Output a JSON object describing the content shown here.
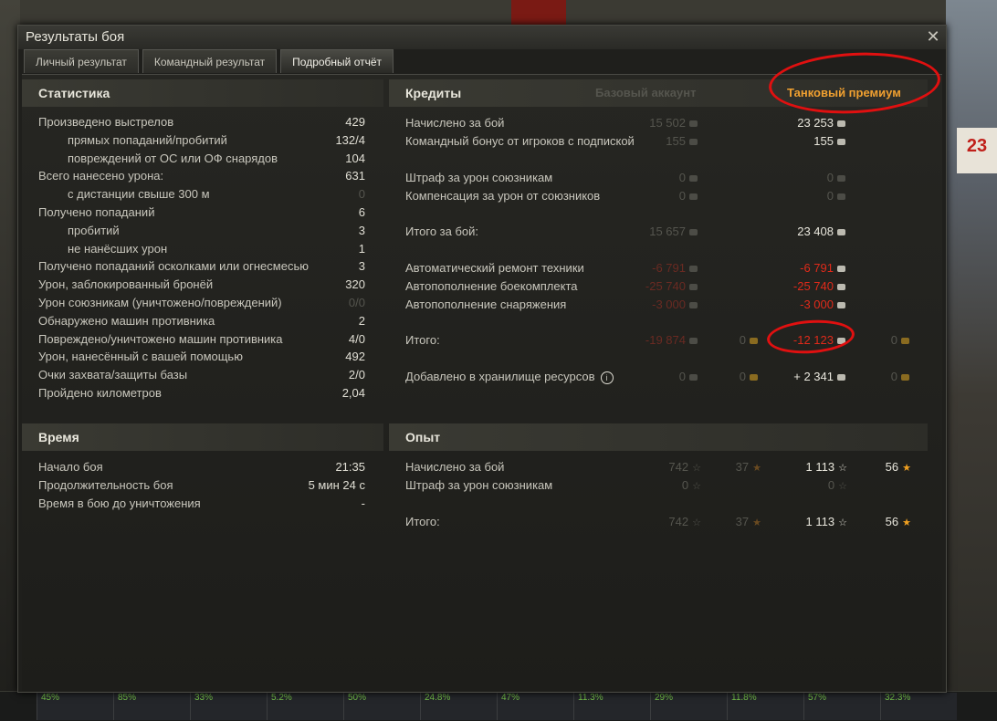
{
  "window": {
    "title": "Результаты боя",
    "close_icon": "close-icon"
  },
  "tabs": [
    {
      "label": "Личный результат",
      "active": false
    },
    {
      "label": "Командный результат",
      "active": false
    },
    {
      "label": "Подробный отчёт",
      "active": true
    }
  ],
  "stats": {
    "header": "Статистика",
    "rows": [
      {
        "label": "Произведено выстрелов",
        "value": "429",
        "indent": false
      },
      {
        "label": "прямых попаданий/пробитий",
        "value": "132/4",
        "indent": true
      },
      {
        "label": "повреждений от ОС или ОФ снарядов",
        "value": "104",
        "indent": true
      },
      {
        "label": "Всего нанесено урона:",
        "value": "631",
        "indent": false
      },
      {
        "label": "с дистанции свыше 300 м",
        "value": "0",
        "indent": true,
        "dim": true
      },
      {
        "label": "Получено попаданий",
        "value": "6",
        "indent": false
      },
      {
        "label": "пробитий",
        "value": "3",
        "indent": true
      },
      {
        "label": "не нанёсших урон",
        "value": "1",
        "indent": true
      },
      {
        "label": "Получено попаданий осколками или огнесмесью",
        "value": "3",
        "indent": false
      },
      {
        "label": "Урон, заблокированный бронёй",
        "value": "320",
        "indent": false
      },
      {
        "label": "Урон союзникам (уничтожено/повреждений)",
        "value": "0/0",
        "indent": false,
        "dim": true
      },
      {
        "label": "Обнаружено машин противника",
        "value": "2",
        "indent": false
      },
      {
        "label": "Повреждено/уничтожено машин противника",
        "value": "4/0",
        "indent": false
      },
      {
        "label": "Урон, нанесённый с вашей помощью",
        "value": "492",
        "indent": false
      },
      {
        "label": "Очки захвата/защиты базы",
        "value": "2/0",
        "indent": false
      },
      {
        "label": "Пройдено километров",
        "value": "2,04",
        "indent": false
      }
    ]
  },
  "time": {
    "header": "Время",
    "rows": [
      {
        "label": "Начало боя",
        "value": "21:35"
      },
      {
        "label": "Продолжительность боя",
        "value": "5 мин 24 с"
      },
      {
        "label": "Время в бою до уничтожения",
        "value": "-"
      }
    ]
  },
  "credits": {
    "header": "Кредиты",
    "col_basic": "Базовый аккаунт",
    "col_premium": "Танковый премиум",
    "rows": [
      {
        "label": "Начислено за бой",
        "basic": "15 502",
        "premium": "23 253"
      },
      {
        "label": "Командный бонус от игроков с подпиской",
        "basic": "155",
        "premium": "155"
      },
      {
        "label": "Штраф за урон союзникам",
        "basic": "0",
        "premium": "0",
        "premium_dim": true
      },
      {
        "label": "Компенсация за урон от союзников",
        "basic": "0",
        "premium": "0",
        "premium_dim": true
      },
      {
        "label": "Итого за бой:",
        "basic": "15 657",
        "premium": "23 408"
      },
      {
        "label": "Автоматический ремонт техники",
        "basic": "-6 791",
        "premium": "-6 791",
        "negative": true
      },
      {
        "label": "Автопополнение боекомплекта",
        "basic": "-25 740",
        "premium": "-25 740",
        "negative": true
      },
      {
        "label": "Автопополнение снаряжения",
        "basic": "-3 000",
        "premium": "-3 000",
        "negative": true
      },
      {
        "label": "Итого:",
        "basic": "-19 874",
        "basic_gold": "0",
        "premium": "-12 123",
        "premium_gold": "0",
        "negative": true
      },
      {
        "label": "Добавлено в хранилище ресурсов",
        "basic": "0",
        "basic_gold": "0",
        "premium": "+ 2 341",
        "premium_gold": "0",
        "info": true
      }
    ]
  },
  "experience": {
    "header": "Опыт",
    "rows": [
      {
        "label": "Начислено за бой",
        "basic": "742",
        "basic_free": "37",
        "premium": "1 113",
        "premium_free": "56"
      },
      {
        "label": "Штраф за урон союзникам",
        "basic": "0",
        "premium": "0",
        "premium_dim": true
      },
      {
        "label": "Итого:",
        "basic": "742",
        "basic_free": "37",
        "premium": "1 113",
        "premium_free": "56"
      }
    ]
  },
  "background": {
    "sign_text": "23",
    "bottom_slots": [
      "45%",
      "85%",
      "33%",
      "5.2%",
      "50%",
      "24.8%",
      "47%",
      "11.3%",
      "29%",
      "11.8%",
      "57%",
      "32.3%"
    ]
  },
  "colors": {
    "accent_premium": "#f0a030",
    "negative": "#e02a1a",
    "annotation": "#e01010"
  }
}
